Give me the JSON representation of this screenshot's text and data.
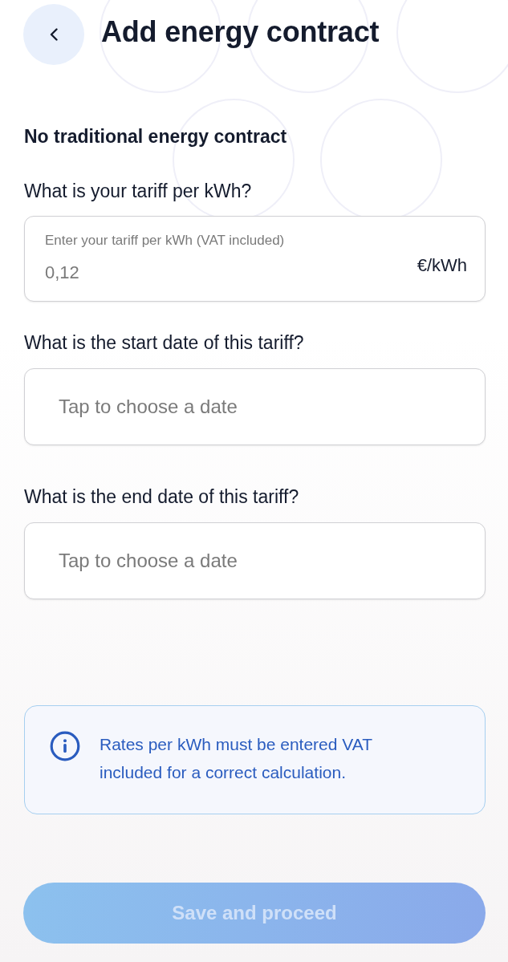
{
  "header": {
    "title": "Add energy contract"
  },
  "section_title": "No traditional energy contract",
  "questions": [
    {
      "kind": "number",
      "label": "What is your tariff per kWh?",
      "field": {
        "floating_label": "Enter your tariff per kWh (VAT included)",
        "value": "0,12",
        "unit": "€/kWh"
      }
    },
    {
      "kind": "date",
      "label": "What is the start date of this tariff?",
      "field": {
        "placeholder": "Tap to choose a date"
      }
    },
    {
      "kind": "date",
      "label": "What is the end date of this tariff?",
      "field": {
        "placeholder": "Tap to choose a date"
      }
    }
  ],
  "info": {
    "text": "Rates per kWh must be entered VAT included for a correct calculation."
  },
  "primary_button": {
    "label": "Save and proceed",
    "disabled": true
  }
}
